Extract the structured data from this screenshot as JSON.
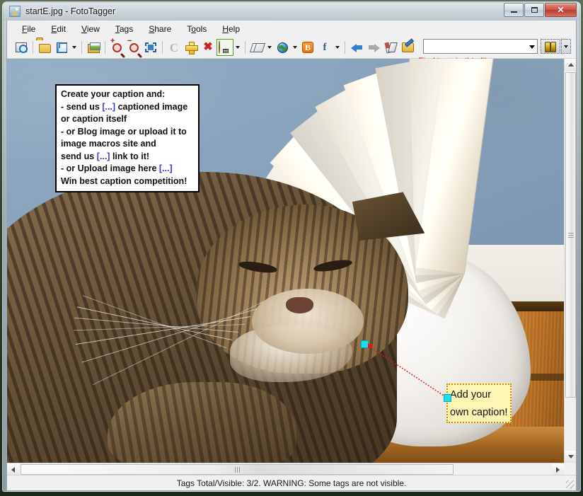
{
  "window": {
    "title": "startE.jpg - FotoTagger",
    "app_icon": "photo-app-icon",
    "minimize_label": "Minimize",
    "maximize_label": "Restore",
    "close_label": "Close"
  },
  "menu": {
    "items": [
      {
        "label": "File",
        "accel": "F"
      },
      {
        "label": "Edit",
        "accel": "E"
      },
      {
        "label": "View",
        "accel": "V"
      },
      {
        "label": "Tags",
        "accel": "T"
      },
      {
        "label": "Share",
        "accel": "S"
      },
      {
        "label": "Tools",
        "accel": "o"
      },
      {
        "label": "Help",
        "accel": "H"
      }
    ]
  },
  "toolbar": {
    "buttons": [
      {
        "name": "search-image-button",
        "icon": "image-search-icon",
        "tooltip": "Search image"
      },
      {
        "name": "open-button",
        "icon": "folder-open-icon",
        "tooltip": "Open"
      },
      {
        "name": "save-button",
        "icon": "floppy-save-icon",
        "tooltip": "Save"
      },
      {
        "name": "save-dropdown",
        "icon": "chevron-down-icon",
        "tooltip": "Save options"
      },
      {
        "name": "open-image-button",
        "icon": "open-image-icon",
        "tooltip": "Open image"
      },
      {
        "name": "zoom-in-button",
        "icon": "zoom-in-icon",
        "tooltip": "Zoom in"
      },
      {
        "name": "zoom-out-button",
        "icon": "zoom-out-icon",
        "tooltip": "Zoom out"
      },
      {
        "name": "fit-to-window-button",
        "icon": "fit-to-window-icon",
        "tooltip": "Fit to window"
      },
      {
        "name": "refresh-button",
        "icon": "refresh-icon",
        "tooltip": "Refresh"
      },
      {
        "name": "add-tag-button",
        "icon": "plus-icon",
        "tooltip": "Add tag"
      },
      {
        "name": "delete-tag-button",
        "icon": "delete-x-icon",
        "tooltip": "Delete tag"
      },
      {
        "name": "show-tags-button",
        "icon": "lightbulb-icon",
        "tooltip": "Show tags"
      },
      {
        "name": "show-tags-dropdown",
        "icon": "chevron-down-icon",
        "tooltip": "Show tags options"
      },
      {
        "name": "tag-style-button",
        "icon": "tags-icon",
        "tooltip": "Tag style"
      },
      {
        "name": "tag-style-dropdown",
        "icon": "chevron-down-icon",
        "tooltip": "Tag style options"
      },
      {
        "name": "publish-web-button",
        "icon": "globe-icon",
        "tooltip": "Publish to web"
      },
      {
        "name": "publish-web-dropdown",
        "icon": "chevron-down-icon",
        "tooltip": "Publish options"
      },
      {
        "name": "blogger-button",
        "icon": "blogger-icon",
        "tooltip": "Blogger"
      },
      {
        "name": "facebook-button",
        "icon": "facebook-icon",
        "tooltip": "Facebook"
      },
      {
        "name": "share-dropdown",
        "icon": "chevron-down-icon",
        "tooltip": "Share options"
      },
      {
        "name": "previous-image-button",
        "icon": "arrow-left-icon",
        "tooltip": "Previous image"
      },
      {
        "name": "next-image-button",
        "icon": "arrow-right-icon",
        "tooltip": "Next image"
      },
      {
        "name": "marker-tool-button",
        "icon": "marker-icon",
        "tooltip": "Marker"
      },
      {
        "name": "edit-folder-button",
        "icon": "edit-folder-icon",
        "tooltip": "Edit folder"
      }
    ],
    "blogger_letter": "B",
    "facebook_letter": "f",
    "refresh_letter": "C"
  },
  "search": {
    "value": "",
    "placeholder": "",
    "dropdown_icon": "chevron-down-icon",
    "find_button_icon": "binoculars-icon",
    "find_dropdown_icon": "chevron-down-icon",
    "hint": "Find tags in this file",
    "hint_color": "#d02020"
  },
  "photo": {
    "info_note": {
      "lines": [
        [
          {
            "t": "Create your caption and:",
            "link": false
          }
        ],
        [
          {
            "t": " - send us ",
            "link": false
          },
          {
            "t": "[...]",
            "link": true
          },
          {
            "t": "  captioned image",
            "link": false
          }
        ],
        [
          {
            "t": "   or caption itself",
            "link": false
          }
        ],
        [
          {
            "t": " - or Blog image or upload it to",
            "link": false
          }
        ],
        [
          {
            "t": "   image macros site and",
            "link": false
          }
        ],
        [
          {
            "t": "   send  us  ",
            "link": false
          },
          {
            "t": "[...]",
            "link": true
          },
          {
            "t": "  link to it!",
            "link": false
          }
        ],
        [
          {
            "t": "-  or Upload image here  ",
            "link": false
          },
          {
            "t": "[...]",
            "link": true
          }
        ],
        [
          {
            "t": "Win best caption competition!",
            "link": false
          }
        ]
      ],
      "link_color": "#3a3ad0",
      "border_color": "#000000",
      "background": "#ffffff"
    },
    "caption_note": {
      "line1": "Add your",
      "line2": "own caption!",
      "background": "#fdf6b4",
      "border_color": "#d08a00",
      "handle_color": "#18e0ee",
      "anchor_dot_color": "#e81414",
      "leader_color": "#e81414"
    },
    "scene_description": "sleeping tabby cat beside a white lamp base under a pleated cream lampshade against a blue-grey wall"
  },
  "scrollbars": {
    "vertical": {
      "up_icon": "triangle-up-icon",
      "down_icon": "triangle-down-icon",
      "grip_icon": "grip-icon"
    },
    "horizontal": {
      "left_icon": "triangle-left-icon",
      "right_icon": "triangle-right-icon",
      "grip_icon": "grip-icon"
    }
  },
  "status": {
    "text": "Tags Total/Visible: 3/2. WARNING: Some tags are not visible.",
    "grip_icon": "resize-grip-icon"
  }
}
